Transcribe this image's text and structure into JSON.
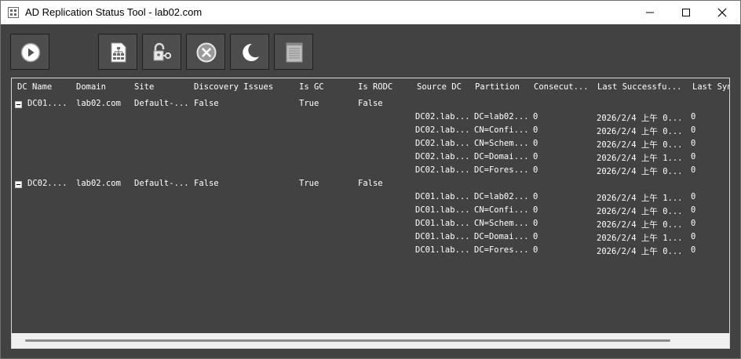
{
  "window": {
    "title": "AD Replication Status Tool - lab02.com"
  },
  "toolbar": {
    "buttons": [
      {
        "name": "run-button",
        "icon": "play-circle-icon"
      },
      {
        "name": "topology-button",
        "icon": "network-document-icon"
      },
      {
        "name": "credentials-button",
        "icon": "lock-key-icon"
      },
      {
        "name": "cancel-button",
        "icon": "x-circle-icon"
      },
      {
        "name": "dark-mode-button",
        "icon": "crescent-moon-icon"
      },
      {
        "name": "log-button",
        "icon": "notepad-icon"
      }
    ]
  },
  "grid": {
    "columns": [
      "DC Name",
      "Domain",
      "Site",
      "Discovery Issues",
      "Is GC",
      "Is RODC",
      "Source DC",
      "Partition",
      "Consecut...",
      "Last Successfu...",
      "Last Syn"
    ],
    "groups": [
      {
        "dc_name": "DC01....",
        "domain": "lab02.com",
        "site": "Default-...",
        "discovery_issues": "False",
        "is_gc": "True",
        "is_rodc": "False",
        "rows": [
          {
            "source_dc": "DC02.lab...",
            "partition": "DC=lab02...",
            "consecutive": "0",
            "last_success": "2026/2/4 上午 0...",
            "last_sync": "0"
          },
          {
            "source_dc": "DC02.lab...",
            "partition": "CN=Confi...",
            "consecutive": "0",
            "last_success": "2026/2/4 上午 0...",
            "last_sync": "0"
          },
          {
            "source_dc": "DC02.lab...",
            "partition": "CN=Schem...",
            "consecutive": "0",
            "last_success": "2026/2/4 上午 0...",
            "last_sync": "0"
          },
          {
            "source_dc": "DC02.lab...",
            "partition": "DC=Domai...",
            "consecutive": "0",
            "last_success": "2026/2/4 上午 1...",
            "last_sync": "0"
          },
          {
            "source_dc": "DC02.lab...",
            "partition": "DC=Fores...",
            "consecutive": "0",
            "last_success": "2026/2/4 上午 0...",
            "last_sync": "0"
          }
        ]
      },
      {
        "dc_name": "DC02....",
        "domain": "lab02.com",
        "site": "Default-...",
        "discovery_issues": "False",
        "is_gc": "True",
        "is_rodc": "False",
        "rows": [
          {
            "source_dc": "DC01.lab...",
            "partition": "DC=lab02...",
            "consecutive": "0",
            "last_success": "2026/2/4 上午 1...",
            "last_sync": "0"
          },
          {
            "source_dc": "DC01.lab...",
            "partition": "CN=Confi...",
            "consecutive": "0",
            "last_success": "2026/2/4 上午 0...",
            "last_sync": "0"
          },
          {
            "source_dc": "DC01.lab...",
            "partition": "CN=Schem...",
            "consecutive": "0",
            "last_success": "2026/2/4 上午 0...",
            "last_sync": "0"
          },
          {
            "source_dc": "DC01.lab...",
            "partition": "DC=Domai...",
            "consecutive": "0",
            "last_success": "2026/2/4 上午 1...",
            "last_sync": "0"
          },
          {
            "source_dc": "DC01.lab...",
            "partition": "DC=Fores...",
            "consecutive": "0",
            "last_success": "2026/2/4 上午 0...",
            "last_sync": "0"
          }
        ]
      }
    ]
  }
}
